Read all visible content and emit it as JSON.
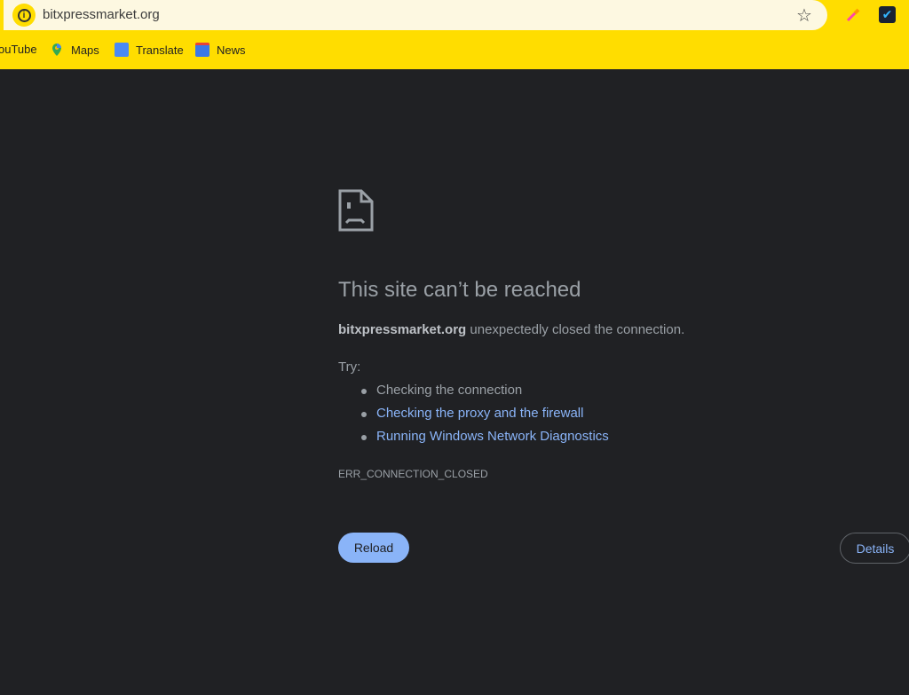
{
  "browser": {
    "url": "bitxpressmarket.org",
    "bookmarks": [
      {
        "label": "ouTube"
      },
      {
        "label": "Maps"
      },
      {
        "label": "Translate"
      },
      {
        "label": "News"
      }
    ]
  },
  "error": {
    "title": "This site can’t be reached",
    "host": "bitxpressmarket.org",
    "message": " unexpectedly closed the connection.",
    "try_label": "Try:",
    "suggestions": [
      "Checking the connection",
      "Checking the proxy and the firewall",
      "Running Windows Network Diagnostics"
    ],
    "code": "ERR_CONNECTION_CLOSED",
    "reload_label": "Reload",
    "details_label": "Details"
  },
  "colors": {
    "toolbar": "#ffdd00",
    "background": "#202124",
    "link": "#8ab4f8"
  }
}
